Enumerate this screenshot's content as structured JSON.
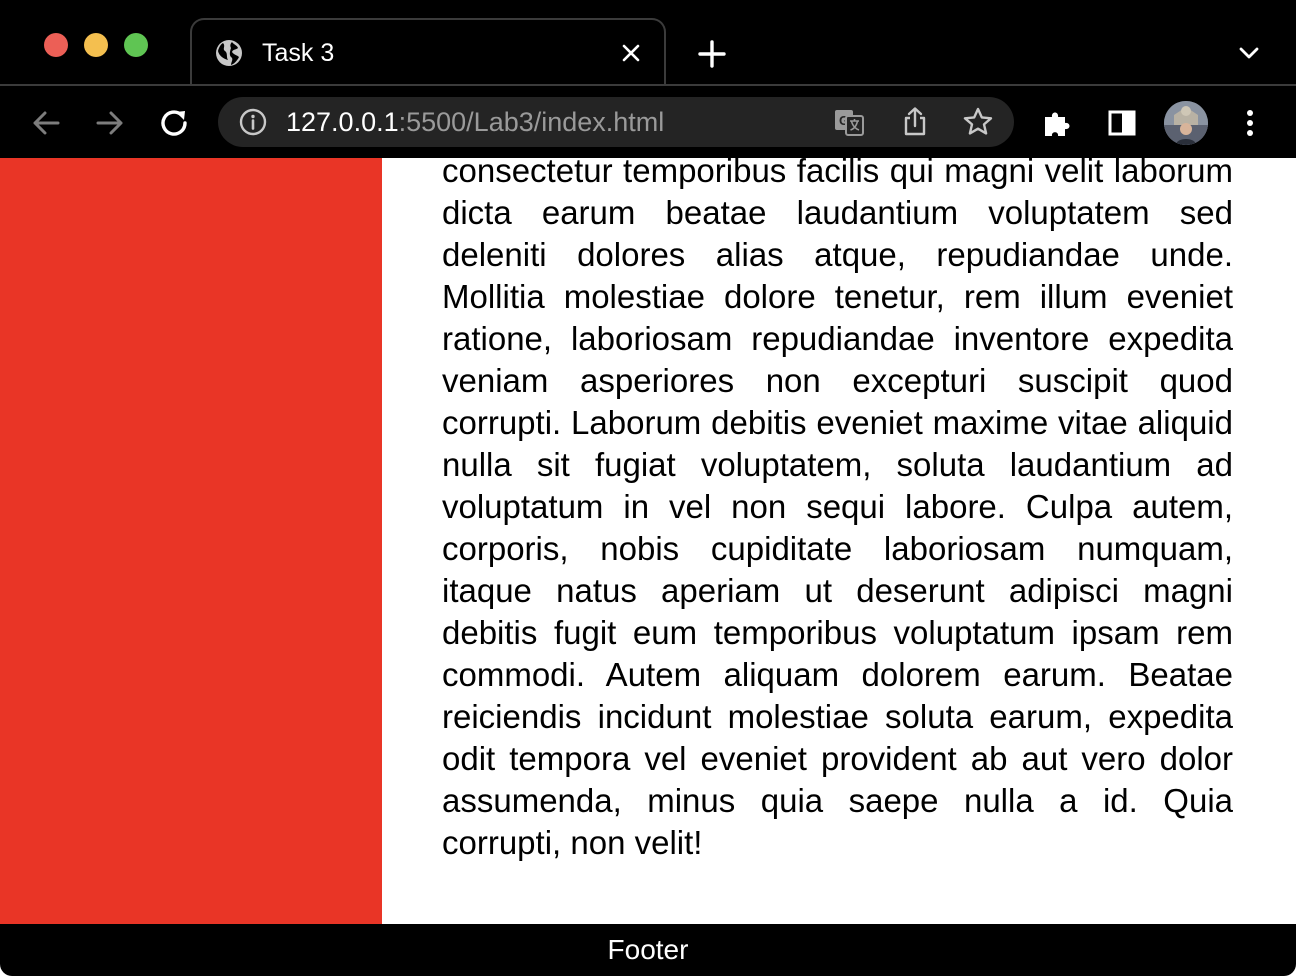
{
  "browser": {
    "tab": {
      "title": "Task 3",
      "favicon": "globe-icon"
    },
    "toolbar": {
      "url_host": "127.0.0.1",
      "url_rest": ":5500/Lab3/index.html",
      "icons": [
        "back-arrow-icon",
        "forward-arrow-icon",
        "reload-icon",
        "info-icon",
        "translate-icon",
        "share-icon",
        "bookmark-star-icon",
        "extensions-puzzle-icon",
        "side-panel-icon",
        "profile-avatar",
        "menu-kebab-icon"
      ]
    }
  },
  "colors": {
    "sidebar": "#e93526",
    "footer": "#000000",
    "content_background": "#ffffff"
  },
  "page": {
    "paragraph": "consectetur temporibus facilis qui magni velit laborum dicta earum beatae laudantium voluptatem sed deleniti dolores alias atque, repudiandae unde. Mollitia molestiae dolore tenetur, rem illum eveniet ratione, laboriosam repudiandae inventore expedita veniam asperiores non excepturi suscipit quod corrupti. Laborum debitis eveniet maxime vitae aliquid nulla sit fugiat voluptatem, soluta laudantium ad voluptatum in vel non sequi labore. Culpa autem, corporis, nobis cupiditate laboriosam numquam, itaque natus aperiam ut deserunt adipisci magni debitis fugit eum temporibus voluptatum ipsam rem commodi. Autem aliquam dolorem earum. Beatae reiciendis incidunt molestiae soluta earum, expedita odit tempora vel eveniet provident ab aut vero dolor assumenda, minus quia saepe nulla a id. Quia corrupti, non velit!",
    "footer": "Footer"
  }
}
